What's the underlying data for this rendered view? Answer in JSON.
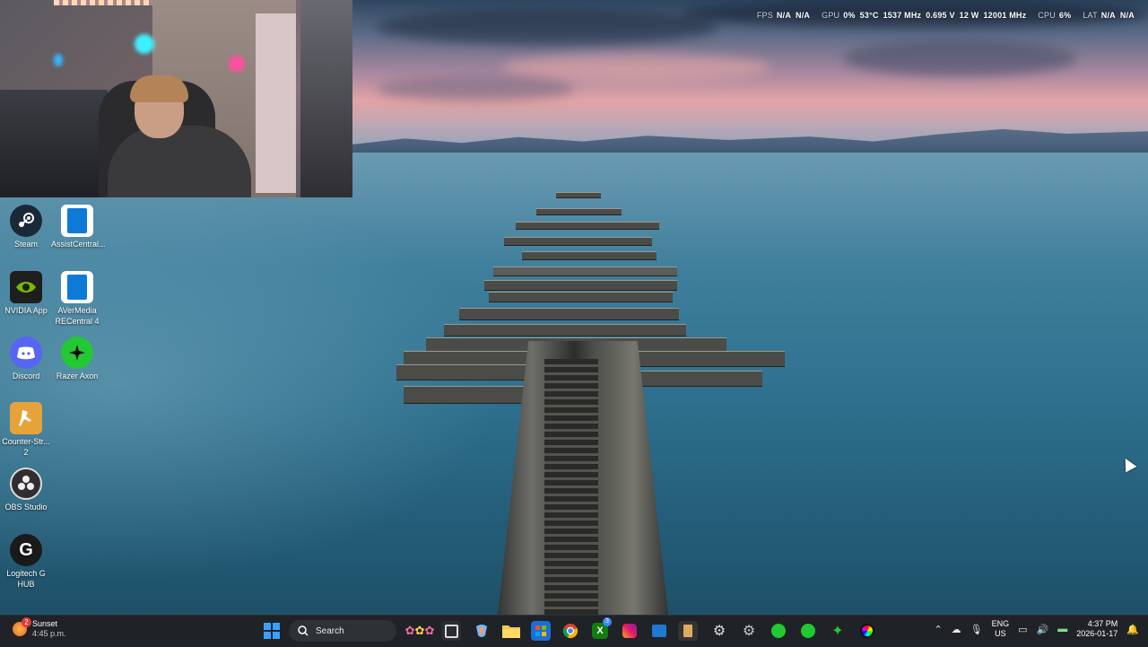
{
  "overlay": {
    "fps_label": "FPS",
    "fps_val1": "N/A",
    "fps_val2": "N/A",
    "gpu_label": "GPU",
    "gpu_load": "0%",
    "gpu_temp": "53°C",
    "gpu_clock": "1537 MHz",
    "gpu_volt": "0.695 V",
    "gpu_power": "12 W",
    "gpu_mem": "12001 MHz",
    "cpu_label": "CPU",
    "cpu_load": "6%",
    "lat_label": "LAT",
    "lat_val1": "N/A",
    "lat_val2": "N/A"
  },
  "desktop_icons": [
    {
      "label": "Steam",
      "icon": "steam-icon",
      "color": "#1b2838"
    },
    {
      "label": "AssistCentral...",
      "icon": "assistcentral-icon",
      "color": "#0e7ad8"
    },
    {
      "label": "NVIDIA App",
      "icon": "nvidia-icon",
      "color": "#76b900"
    },
    {
      "label": "AVerMedia RECentral 4",
      "icon": "avermedia-icon",
      "color": "#0e7ad8"
    },
    {
      "label": "Discord",
      "icon": "discord-icon",
      "color": "#5865f2"
    },
    {
      "label": "Razer Axon",
      "icon": "razer-axon-icon",
      "color": "#22c932"
    },
    {
      "label": "Counter-Str... 2",
      "icon": "counter-strike-icon",
      "color": "#e8a23a"
    },
    {
      "label": "OBS Studio",
      "icon": "obs-icon",
      "color": "#302e31"
    },
    {
      "label": "Logitech G HUB",
      "icon": "logitech-g-icon",
      "color": "#1a1a1a"
    }
  ],
  "taskbar": {
    "weather_title": "Sunset",
    "weather_time": "4:45 p.m.",
    "weather_badge": "2",
    "search_placeholder": "Search",
    "lang_top": "ENG",
    "lang_bottom": "US",
    "clock_time": "4:37 PM",
    "clock_date": "2026-01-17",
    "chrome_badge": "3"
  }
}
